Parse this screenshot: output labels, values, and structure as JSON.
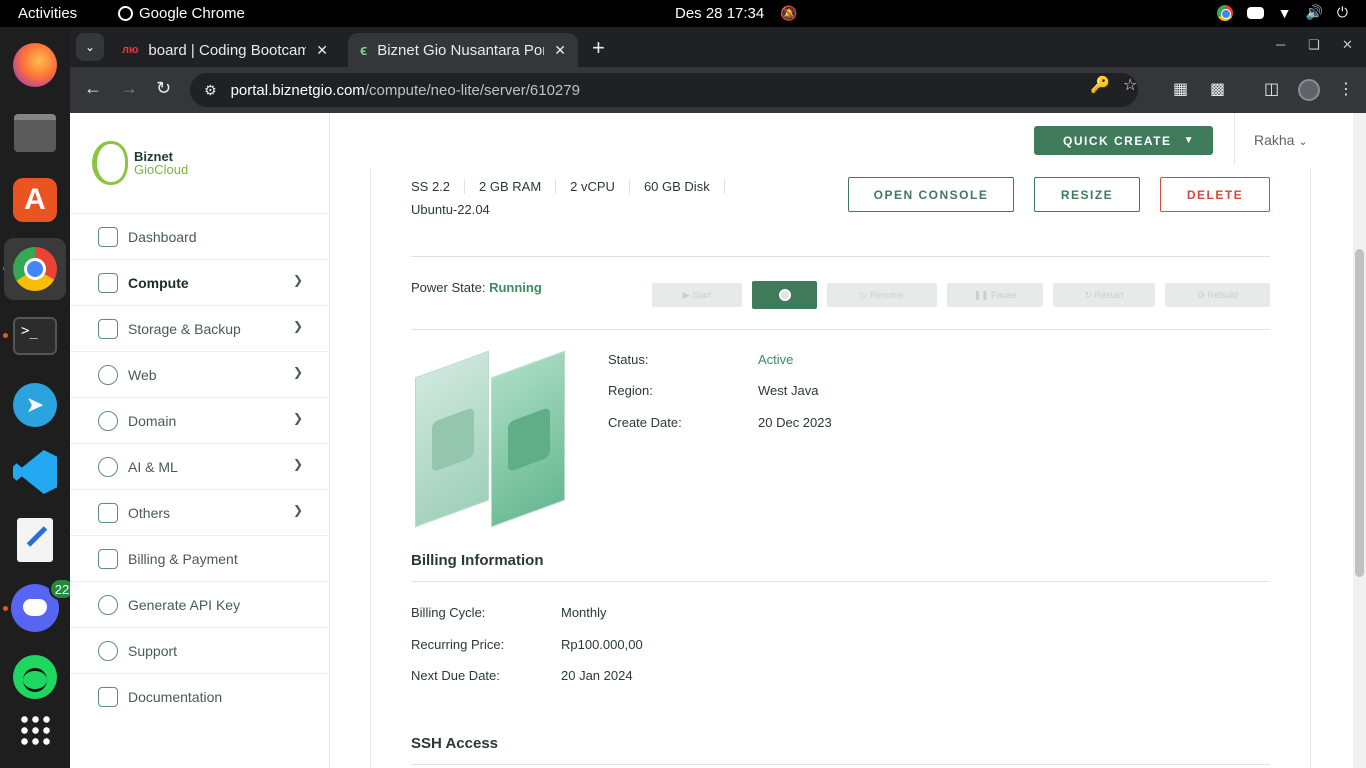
{
  "topbar": {
    "activities": "Activities",
    "app_name": "Google Chrome",
    "clock": "Des 28  17:34"
  },
  "dock": {
    "discord_badge": "22"
  },
  "browser": {
    "tabs": [
      {
        "title": "board | Coding Bootcamp",
        "favicon": "board-favicon"
      },
      {
        "title": "Biznet Gio Nusantara Portal",
        "favicon": "biznet-favicon"
      }
    ],
    "url_host": "portal.biznetgio.com",
    "url_path": "/compute/neo-lite/server/610279"
  },
  "sidebar": {
    "logo_line1": "Biznet",
    "logo_line2": "GioCloud",
    "items": [
      {
        "label": "Dashboard",
        "icon": "home-icon",
        "expandable": false
      },
      {
        "label": "Compute",
        "icon": "compute-icon",
        "expandable": true
      },
      {
        "label": "Storage & Backup",
        "icon": "storage-icon",
        "expandable": true
      },
      {
        "label": "Web",
        "icon": "globe-icon",
        "expandable": true
      },
      {
        "label": "Domain",
        "icon": "domain-icon",
        "expandable": true
      },
      {
        "label": "AI & ML",
        "icon": "ai-icon",
        "expandable": true
      },
      {
        "label": "Others",
        "icon": "others-icon",
        "expandable": true
      },
      {
        "label": "Billing & Payment",
        "icon": "billing-icon",
        "expandable": false
      },
      {
        "label": "Generate API Key",
        "icon": "api-key-icon",
        "expandable": false
      },
      {
        "label": "Support",
        "icon": "support-icon",
        "expandable": false
      },
      {
        "label": "Documentation",
        "icon": "documentation-icon",
        "expandable": false
      }
    ]
  },
  "header": {
    "quick_create": "QUICK CREATE",
    "user": "Rakha"
  },
  "server": {
    "specs": [
      "SS 2.2",
      "2 GB RAM",
      "2 vCPU",
      "60 GB Disk"
    ],
    "os": "Ubuntu-22.04",
    "actions": {
      "open_console": "OPEN CONSOLE",
      "resize": "RESIZE",
      "delete": "DELETE"
    },
    "power_label": "Power State:",
    "power_state": "Running",
    "power_buttons": {
      "start": "Start",
      "resume": "Resume",
      "pause": "Pause",
      "restart": "Restart",
      "rebuild": "Rebuild"
    },
    "details": [
      {
        "label": "Status:",
        "value": "Active"
      },
      {
        "label": "Region:",
        "value": "West Java"
      },
      {
        "label": "Create Date:",
        "value": "20 Dec 2023"
      }
    ]
  },
  "billing": {
    "title": "Billing Information",
    "rows": [
      {
        "label": "Billing Cycle:",
        "value": "Monthly"
      },
      {
        "label": "Recurring Price:",
        "value": "Rp100.000,00"
      },
      {
        "label": "Next Due Date:",
        "value": "20 Jan 2024"
      }
    ]
  },
  "ssh": {
    "title": "SSH Access"
  },
  "colors": {
    "brand_green": "#3f7a5b",
    "status_green": "#3f8a5f",
    "danger": "#d44a3a"
  }
}
